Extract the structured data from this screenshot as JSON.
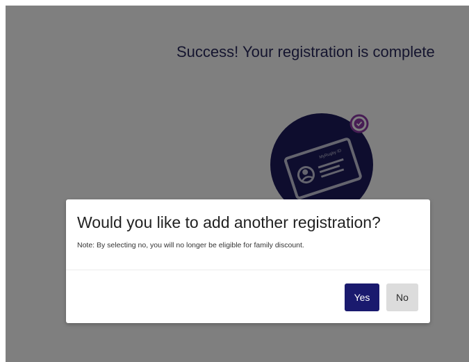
{
  "page": {
    "success_message": "Success! Your registration is complete"
  },
  "illustration": {
    "icon": "id-card-icon",
    "card_label": "MyRugby ID",
    "badge_icon": "check-circle-icon"
  },
  "modal": {
    "title": "Would you like to add another registration?",
    "note": "Note: By selecting no, you will no longer be eligible for family discount.",
    "yes_label": "Yes",
    "no_label": "No"
  },
  "colors": {
    "primary": "#1a1a6e",
    "badge": "#8e3aa8",
    "overlay": "rgba(0,0,0,0.5)"
  }
}
